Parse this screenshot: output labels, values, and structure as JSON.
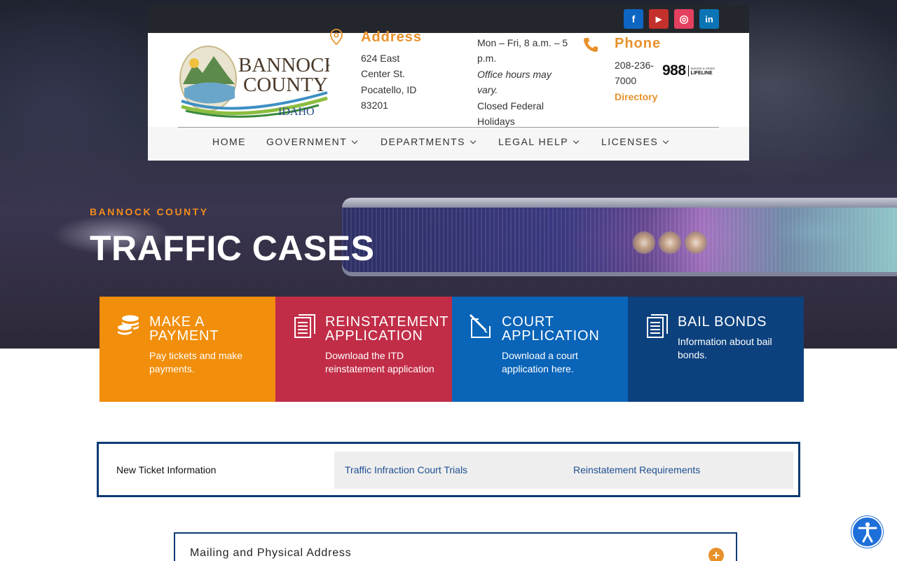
{
  "social": {
    "facebook": {
      "glyph": "f",
      "color": "#0e66c2"
    },
    "youtube": {
      "glyph": "▶",
      "color": "#c4302b"
    },
    "instagram": {
      "glyph": "◎",
      "color": "#e4405f"
    },
    "linkedin": {
      "glyph": "in",
      "color": "#0a74b5"
    }
  },
  "logo": {
    "line1": "BANNOCK",
    "line2": "COUNTY",
    "line3": "IDAHO"
  },
  "address": {
    "title": "Address",
    "line1": "624 East",
    "line2": "Center St.",
    "line3": "Pocatello, ID",
    "line4": "83201"
  },
  "hours": {
    "line1": "Mon – Fri, 8 a.m. – 5",
    "line2": "p.m.",
    "line3": "Office hours may",
    "line4": "vary.",
    "line5": "Closed Federal",
    "line6": "Holidays"
  },
  "phone": {
    "title": "Phone",
    "line1": "208-236-",
    "line2": "7000",
    "directory_link": "Directory"
  },
  "lifeline": {
    "number": "988",
    "small_top": "SUICIDE & CRISIS",
    "small_bottom": "LIFELINE"
  },
  "nav": {
    "home": "HOME",
    "government": "GOVERNMENT",
    "departments": "DEPARTMENTS",
    "legal_help": "LEGAL HELP",
    "licenses": "LICENSES"
  },
  "hero": {
    "kicker": "BANNOCK COUNTY",
    "title": "TRAFFIC CASES"
  },
  "cards": [
    {
      "title1": "MAKE A",
      "title2": "PAYMENT",
      "desc1": "Pay tickets and make",
      "desc2": "payments.",
      "color": "#f18e0b",
      "icon": "coins-icon"
    },
    {
      "title1": "REINSTATEMENT",
      "title2": "APPLICATION",
      "desc1": "Download the ITD",
      "desc2": "reinstatement application",
      "color": "#c12d47",
      "icon": "document-icon"
    },
    {
      "title1": "COURT",
      "title2": "APPLICATION",
      "desc1": "Download a court",
      "desc2": "application here.",
      "color": "#0a64b8",
      "icon": "edit-icon"
    },
    {
      "title1": "BAIL BONDS",
      "desc1": "Information about bail",
      "desc2": "bonds.",
      "color": "#0c417e",
      "icon": "document-icon"
    }
  ],
  "tabs": {
    "active": "New Ticket Information",
    "tab2": "Traffic Infraction Court Trials",
    "tab3": "Reinstatement Requirements"
  },
  "accordion": {
    "title": "Mailing and Physical Address",
    "toggle": "+"
  },
  "colors": {
    "accent_orange": "#e8912c",
    "navy": "#0d3b73",
    "link_blue": "#1d4f91"
  }
}
